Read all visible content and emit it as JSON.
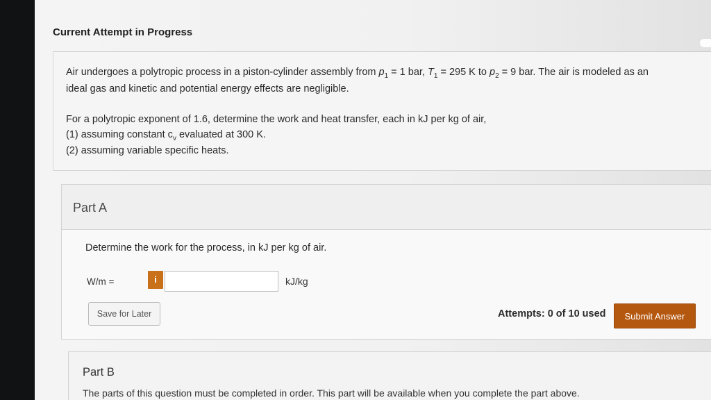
{
  "header": {
    "title": "Current Attempt in Progress"
  },
  "question": {
    "line1_a": "Air undergoes a polytropic process in a piston-cylinder assembly from ",
    "p1_sym": "p",
    "p1_sub": "1",
    "p1_val": " = 1 bar, ",
    "T1_sym": "T",
    "T1_sub": "1",
    "T1_val": " = 295 K to ",
    "p2_sym": "p",
    "p2_sub": "2",
    "p2_val": " = 9 bar. The air is modeled as an",
    "line2": "ideal gas and kinetic and potential energy effects are negligible.",
    "line3": "For a polytropic exponent of 1.6, determine the work and heat transfer, each in kJ per kg of air,",
    "line4_a": "(1) assuming constant c",
    "line4_sub": "v",
    "line4_b": " evaluated at 300 K.",
    "line5": "(2) assuming variable specific heats."
  },
  "part_a": {
    "label": "Part A",
    "prompt": "Determine the work for the process, in kJ per kg of air.",
    "eq_label": "W/m =",
    "info_badge": "i",
    "input_value": "",
    "unit": "kJ/kg",
    "save_label": "Save for Later",
    "attempts": "Attempts: 0 of 10 used",
    "submit_label": "Submit Answer"
  },
  "part_b": {
    "label": "Part B",
    "note": "The parts of this question must be completed in order. This part will be available when you complete the part above."
  },
  "colors": {
    "accent": "#b5580f",
    "info_badge": "#c8711a"
  }
}
